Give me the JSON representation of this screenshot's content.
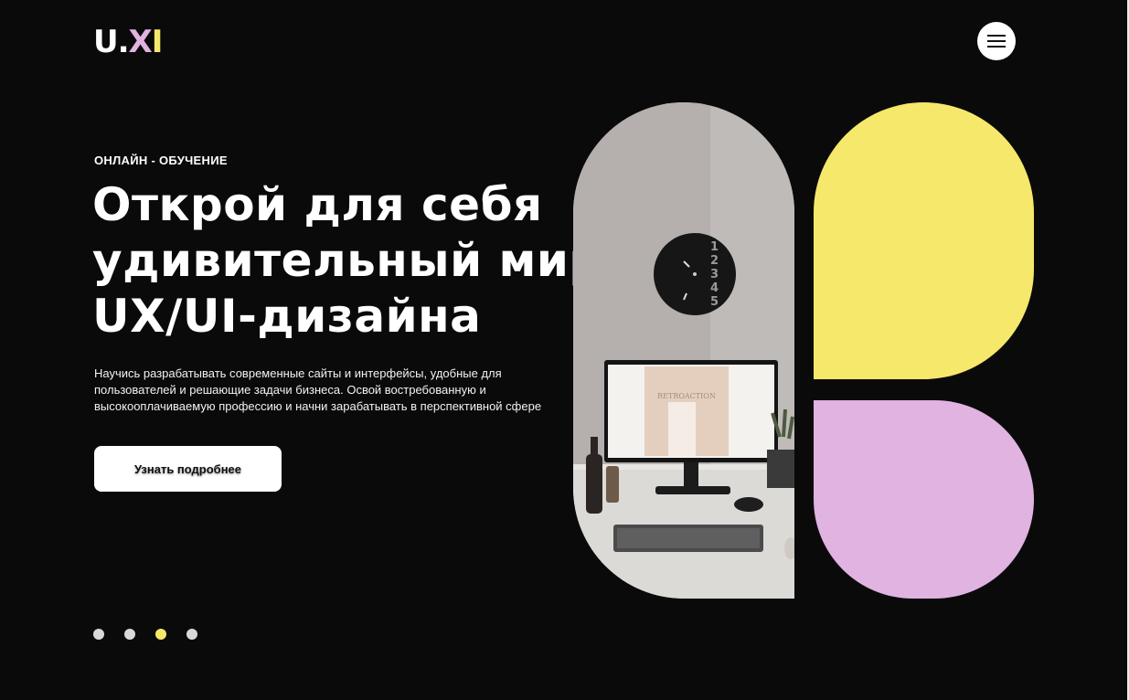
{
  "logo": {
    "part1": "U.",
    "part2": "X",
    "part3": "I"
  },
  "hero": {
    "eyebrow": "ОНЛАЙН - ОБУЧЕНИЕ",
    "title_lines": [
      "Открой для себя",
      "удивительный мир",
      "UX/UI-дизайна"
    ],
    "description_lines": [
      "Научись разрабатывать современные сайты и интерфейсы, удобные для",
      "пользователей и решающие задачи бизнеса. Освой востребованную и",
      "высокооплачиваемую профессию и начни зарабатывать в перспективной сфере"
    ],
    "cta_label": "Узнать подробнее"
  },
  "icons": {
    "menu": "hamburger-menu-icon"
  },
  "photo": {
    "clock_numbers": [
      "1",
      "2",
      "3",
      "4",
      "5"
    ],
    "screen_text": "RETROACTION"
  },
  "slider": {
    "count": 4,
    "active_index": 2
  },
  "colors": {
    "background": "#0b0a0b",
    "accent_yellow": "#f6e86a",
    "accent_pink": "#e0b3e0",
    "button": "#ffffff"
  }
}
